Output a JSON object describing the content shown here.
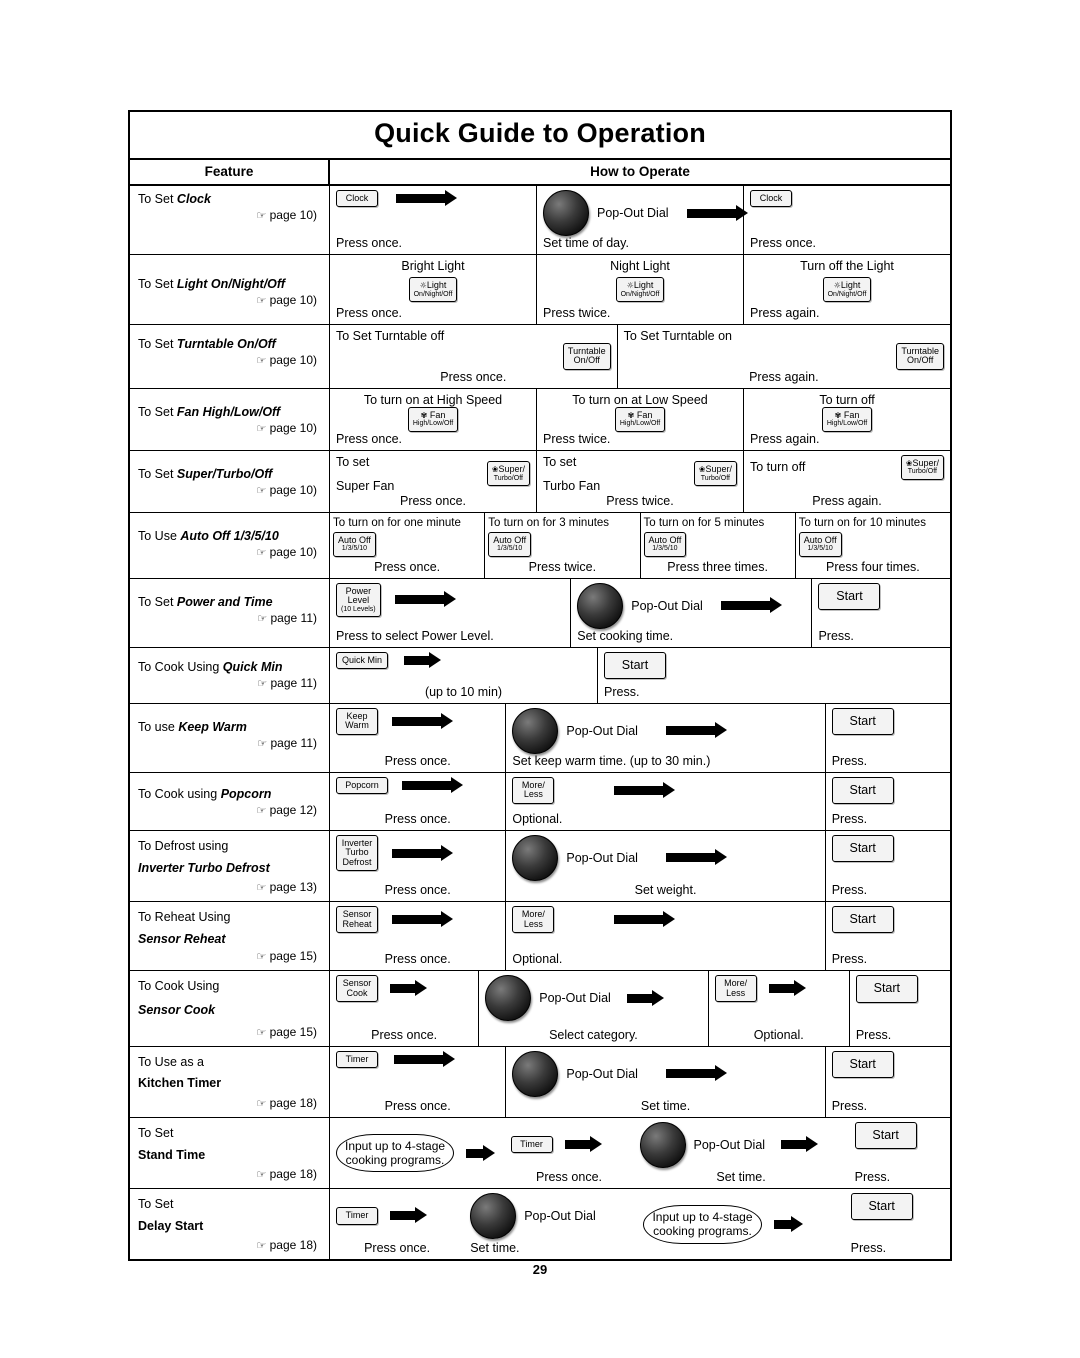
{
  "document": {
    "title": "Quick Guide to Operation",
    "page_number": "29",
    "headers": {
      "feature": "Feature",
      "how_to_operate": "How to Operate"
    }
  },
  "rows": [
    {
      "feature": {
        "prefix": "To Set ",
        "name": "Clock",
        "page": "page 10"
      },
      "cells": [
        {
          "top": "",
          "button": "Clock",
          "arrow": true,
          "bottom": "Press once."
        },
        {
          "top": "",
          "dial": true,
          "dial_label": "Pop-Out Dial",
          "arrow": true,
          "bottom": "Set time of day."
        },
        {
          "top": "",
          "button": "Clock",
          "bottom": "Press once."
        }
      ]
    },
    {
      "feature": {
        "prefix": "To Set ",
        "name": "Light On/Night/Off",
        "page": "page 10"
      },
      "cells": [
        {
          "top": "Bright Light",
          "button": [
            "Light",
            "On/Night/Off"
          ],
          "bottom": "Press once."
        },
        {
          "top": "Night Light",
          "button": [
            "Light",
            "On/Night/Off"
          ],
          "bottom": "Press twice."
        },
        {
          "top": "Turn off the Light",
          "button": [
            "Light",
            "On/Night/Off"
          ],
          "bottom": "Press again."
        }
      ]
    },
    {
      "feature": {
        "prefix": "To Set ",
        "name": "Turntable On/Off",
        "page": "page 10"
      },
      "cells": [
        {
          "top": "To Set Turntable off",
          "button": [
            "Turntable",
            "On/Off"
          ],
          "bottom": "Press once."
        },
        {
          "top": "To Set Turntable on",
          "button": [
            "Turntable",
            "On/Off"
          ],
          "bottom": "Press again."
        }
      ]
    },
    {
      "feature": {
        "prefix": "To Set ",
        "name": "Fan High/Low/Off",
        "page": "page 10"
      },
      "cells": [
        {
          "top": "To turn on at High Speed",
          "button": [
            "Fan",
            "High/Low/Off"
          ],
          "bottom": "Press once."
        },
        {
          "top": "To turn on at Low Speed",
          "button": [
            "Fan",
            "High/Low/Off"
          ],
          "bottom": "Press twice."
        },
        {
          "top": "To turn off",
          "button": [
            "Fan",
            "High/Low/Off"
          ],
          "bottom": "Press again."
        }
      ]
    },
    {
      "feature": {
        "prefix": "To Set ",
        "name": "Super/Turbo/Off",
        "page": "page 10"
      },
      "cells": [
        {
          "top": "To set",
          "top2": "Super Fan",
          "button": [
            "Super/",
            "Turbo/Off"
          ],
          "bottom": "Press once."
        },
        {
          "top": "To set",
          "top2": "Turbo Fan",
          "button": [
            "Super/",
            "Turbo/Off"
          ],
          "bottom": "Press twice."
        },
        {
          "top": "To turn off",
          "button": [
            "Super/",
            "Turbo/Off"
          ],
          "bottom": "Press again."
        }
      ]
    },
    {
      "feature": {
        "prefix": "To Use ",
        "name": "Auto Off 1/3/5/10",
        "page": "page 10"
      },
      "cells": [
        {
          "top": "To turn on for one minute",
          "button": [
            "Auto Off",
            "1/3/5/10"
          ],
          "bottom": "Press once."
        },
        {
          "top": "To turn on for 3 minutes",
          "button": [
            "Auto Off",
            "1/3/5/10"
          ],
          "bottom": "Press twice."
        },
        {
          "top": "To turn on for 5 minutes",
          "button": [
            "Auto Off",
            "1/3/5/10"
          ],
          "bottom": "Press three times."
        },
        {
          "top": "To turn on for 10 minutes",
          "button": [
            "Auto Off",
            "1/3/5/10"
          ],
          "bottom": "Press four times."
        }
      ]
    },
    {
      "feature": {
        "prefix": "To Set ",
        "name": "Power and Time",
        "page": "page 11"
      },
      "cells": [
        {
          "button": [
            "Power",
            "Level",
            "(10 Levels)"
          ],
          "arrow": true,
          "bottom": "Press to select Power Level."
        },
        {
          "dial": true,
          "dial_label": "Pop-Out Dial",
          "arrow": true,
          "bottom": "Set cooking time."
        },
        {
          "button": "Start",
          "bottom": "Press."
        }
      ]
    },
    {
      "feature": {
        "prefix": "To Cook Using ",
        "name": "Quick Min",
        "page": "page 11"
      },
      "cells": [
        {
          "button": "Quick Min",
          "arrow": true,
          "bottom": "(up to 10 min)"
        },
        {
          "button": "Start",
          "bottom": "Press."
        }
      ]
    },
    {
      "feature": {
        "prefix": "To use ",
        "name": "Keep Warm",
        "page": "page 11"
      },
      "cells": [
        {
          "button": [
            "Keep",
            "Warm"
          ],
          "arrow": true,
          "bottom": "Press once."
        },
        {
          "dial": true,
          "dial_label": "Pop-Out Dial",
          "arrow": true,
          "bottom": "Set keep warm time. (up to 30 min.)"
        },
        {
          "button": "Start",
          "bottom": "Press."
        }
      ]
    },
    {
      "feature": {
        "prefix": "To Cook using ",
        "name": "Popcorn",
        "page": "page 12"
      },
      "cells": [
        {
          "button": "Popcorn",
          "arrow": true,
          "bottom": "Press once."
        },
        {
          "button": [
            "More/",
            "Less"
          ],
          "arrow": true,
          "bottom": "Optional."
        },
        {
          "button": "Start",
          "bottom": "Press."
        }
      ]
    },
    {
      "feature": {
        "prefix": "To Defrost using",
        "name": "Inverter Turbo Defrost",
        "page": "page 13"
      },
      "cells": [
        {
          "button": [
            "Inverter",
            "Turbo",
            "Defrost"
          ],
          "arrow": true,
          "bottom": "Press once."
        },
        {
          "dial": true,
          "dial_label": "Pop-Out Dial",
          "arrow": true,
          "bottom": "Set weight."
        },
        {
          "button": "Start",
          "bottom": "Press."
        }
      ]
    },
    {
      "feature": {
        "prefix": "To Reheat Using",
        "name": "Sensor Reheat",
        "page": "page 15"
      },
      "cells": [
        {
          "button": [
            "Sensor",
            "Reheat"
          ],
          "arrow": true,
          "bottom": "Press once."
        },
        {
          "button": [
            "More/",
            "Less"
          ],
          "arrow": true,
          "bottom": "Optional."
        },
        {
          "button": "Start",
          "bottom": "Press."
        }
      ]
    },
    {
      "feature": {
        "prefix": "To Cook Using",
        "name": "Sensor Cook",
        "page": "page 15"
      },
      "cells": [
        {
          "button": [
            "Sensor",
            "Cook"
          ],
          "arrow": true,
          "bottom": "Press once."
        },
        {
          "dial": true,
          "dial_label": "Pop-Out Dial",
          "arrow": true,
          "bottom": "Select category."
        },
        {
          "button": [
            "More/",
            "Less"
          ],
          "arrow": true,
          "bottom": "Optional."
        },
        {
          "button": "Start",
          "bottom": "Press."
        }
      ]
    },
    {
      "feature": {
        "prefix": "To Use as a",
        "name": "Kitchen Timer",
        "page": "page 18"
      },
      "cells": [
        {
          "button": "Timer",
          "arrow": true,
          "bottom": "Press once."
        },
        {
          "dial": true,
          "dial_label": "Pop-Out Dial",
          "arrow": true,
          "bottom": "Set time."
        },
        {
          "button": "Start",
          "bottom": "Press."
        }
      ]
    },
    {
      "feature": {
        "prefix": "To Set",
        "name": "Stand Time",
        "page": "page 18"
      },
      "cells": [
        {
          "brace": [
            "Input up to 4-stage",
            "cooking programs."
          ],
          "arrow": true
        },
        {
          "button": "Timer",
          "arrow": true,
          "bottom": "Press once."
        },
        {
          "dial": true,
          "dial_label": "Pop-Out Dial",
          "arrow": true,
          "bottom": "Set time."
        },
        {
          "button": "Start",
          "bottom": "Press."
        }
      ]
    },
    {
      "feature": {
        "prefix": "To Set",
        "name": "Delay Start",
        "page": "page 18"
      },
      "cells": [
        {
          "button": "Timer",
          "arrow": true,
          "bottom": "Press once."
        },
        {
          "dial": true,
          "dial_label": "Pop-Out Dial",
          "bottom": "Set time."
        },
        {
          "brace": [
            "Input up to 4-stage",
            "cooking programs."
          ],
          "arrow": true
        },
        {
          "button": "Start",
          "bottom": "Press."
        }
      ]
    }
  ]
}
